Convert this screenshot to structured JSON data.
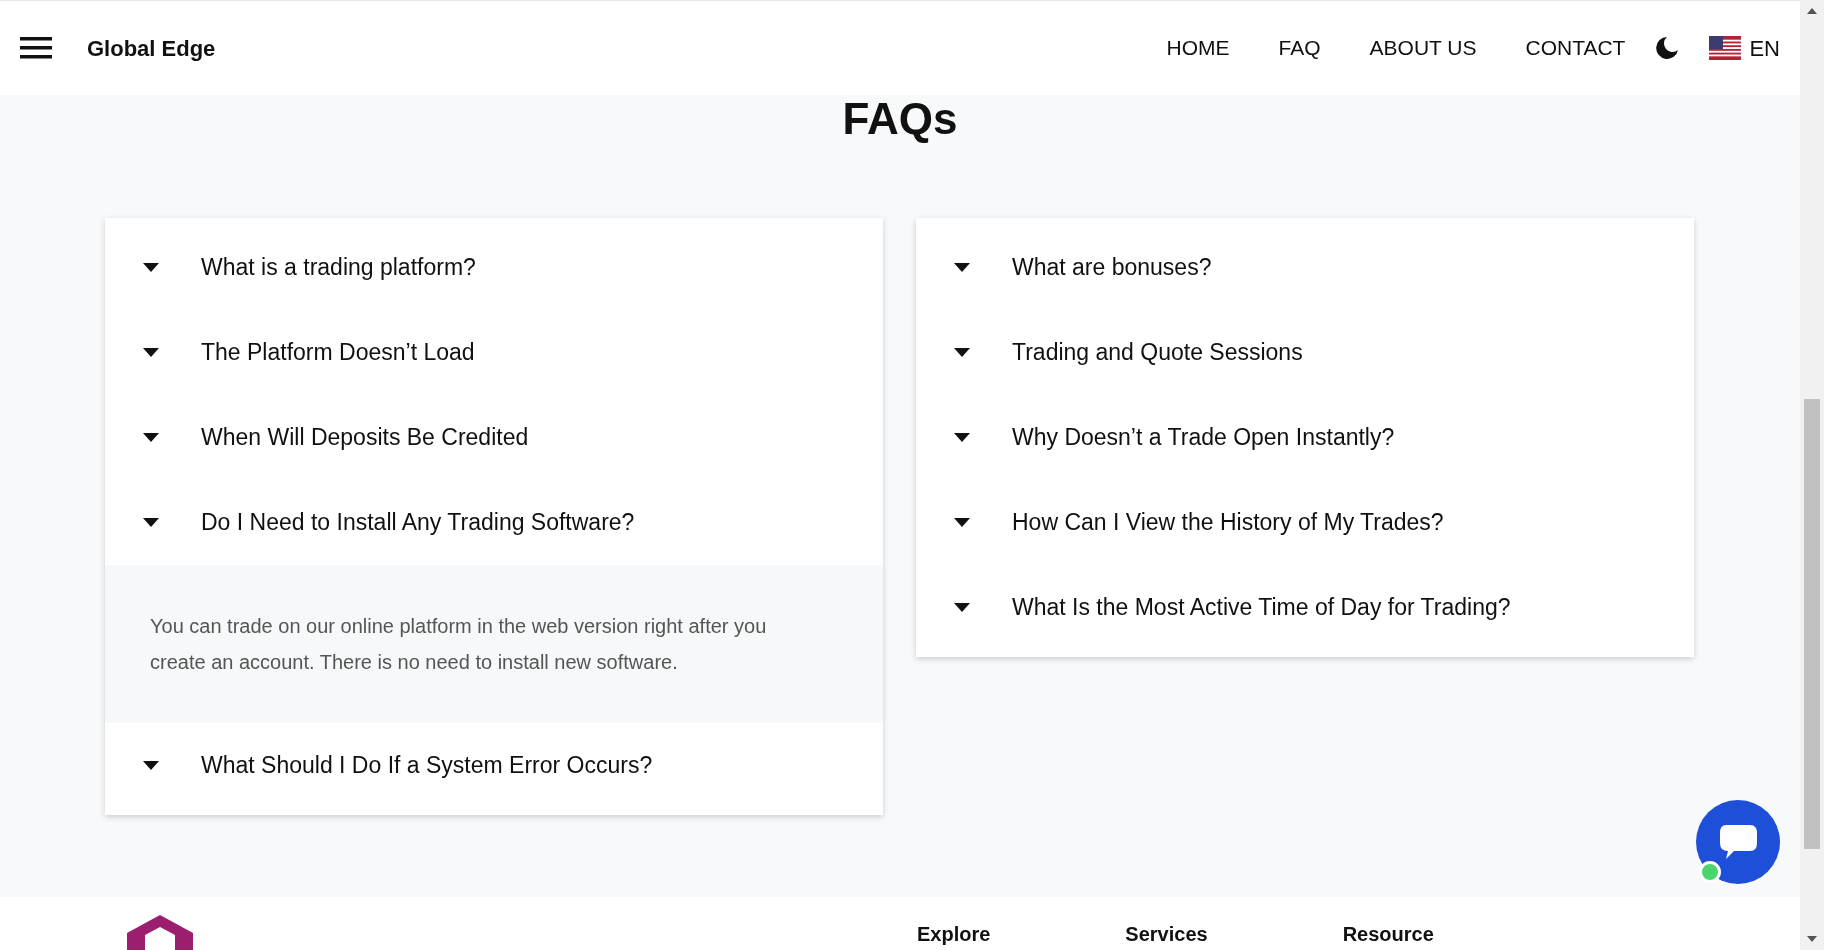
{
  "header": {
    "brand": "Global Edge",
    "nav": [
      "HOME",
      "FAQ",
      "ABOUT US",
      "CONTACT"
    ],
    "language": "EN"
  },
  "title": "FAQs",
  "faq_columns": [
    [
      {
        "question": "What is a trading platform?"
      },
      {
        "question": "The Platform Doesn’t Load"
      },
      {
        "question": "When Will Deposits Be Credited"
      },
      {
        "question": "Do I Need to Install Any Trading Software?",
        "answer": "You can trade on our online platform in the web version right after you create an account. There is no need to install new software."
      },
      {
        "question": "What Should I Do If a System Error Occurs?"
      }
    ],
    [
      {
        "question": "What are bonuses?"
      },
      {
        "question": "Trading and Quote Sessions"
      },
      {
        "question": "Why Doesn’t a Trade Open Instantly?"
      },
      {
        "question": "How Can I View the History of My Trades?"
      },
      {
        "question": "What Is the Most Active Time of Day for Trading?"
      }
    ]
  ],
  "footer": {
    "headings": [
      "Explore",
      "Services",
      "Resource"
    ]
  }
}
